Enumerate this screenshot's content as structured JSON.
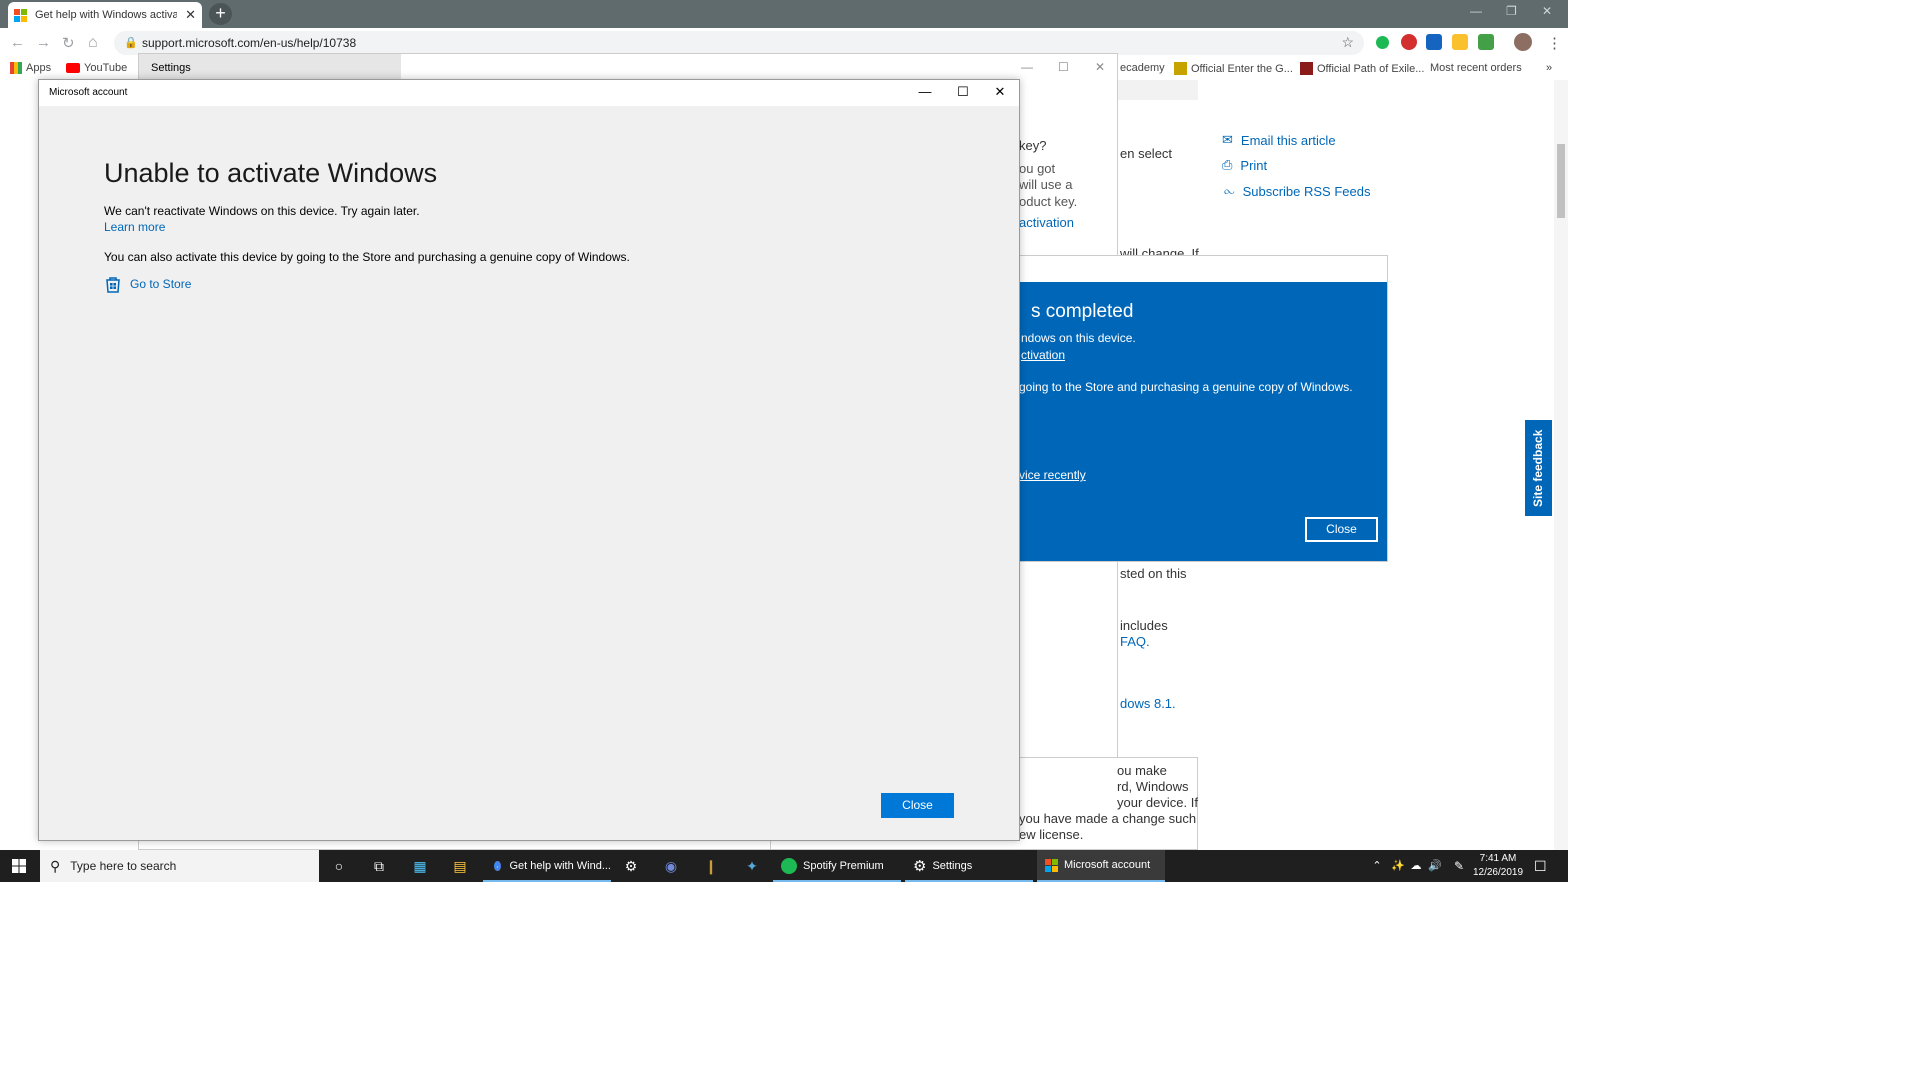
{
  "browser": {
    "tab_title": "Get help with Windows activatio",
    "tab_close": "✕",
    "new_tab": "+",
    "url": "support.microsoft.com/en-us/help/10738",
    "bookmarks": [
      {
        "label": "Apps"
      },
      {
        "label": "YouTube"
      },
      {
        "label": "ecademy"
      },
      {
        "label": "Official Enter the G..."
      },
      {
        "label": "Official Path of Exile..."
      },
      {
        "label": "Most recent orders"
      }
    ],
    "more_bookmarks": "»"
  },
  "webpage": {
    "fragments": {
      "key": "key?",
      "you_got": "ou got",
      "will_use": "will use a",
      "product_key": "oduct key.",
      "activation": "activation",
      "then_select": "en select",
      "will_change": "will change. If",
      "sted_on": "sted on this",
      "includes": "includes",
      "faq": "FAQ.",
      "windows81": "dows 8.1.",
      "you_make": "ou make",
      "rd_windows": "rd, Windows",
      "your_device": "your device. If",
      "you_have_made": "you have made a change such",
      "new_license": "ew license."
    },
    "side_links": {
      "email": "Email this article",
      "print": "Print",
      "rss": "Subscribe RSS Feeds"
    },
    "site_feedback": "Site feedback"
  },
  "settings_window": {
    "title": "Settings"
  },
  "blue_dialog": {
    "title": "s completed",
    "line1": "ndows on this device.",
    "link1": "ctivation",
    "line2": " going to the Store and purchasing a genuine copy of Windows.",
    "link2": "vice recently",
    "close": "Close"
  },
  "ms_dialog": {
    "title": "Microsoft account",
    "heading": "Unable to activate Windows",
    "line1": "We can't reactivate Windows on this device. Try again later.",
    "learn_more": "Learn more",
    "line2": "You can also activate this device by going to the Store and purchasing a genuine copy of Windows.",
    "go_to_store": "Go to Store",
    "close": "Close"
  },
  "taskbar": {
    "search_placeholder": "Type here to search",
    "items": [
      {
        "label": "Get help with Wind..."
      },
      {
        "label": "Spotify Premium"
      },
      {
        "label": "Settings"
      },
      {
        "label": "Microsoft account"
      }
    ],
    "time": "7:41 AM",
    "date": "12/26/2019"
  },
  "colors": {
    "accent": "#0078d7",
    "link": "#0067b8",
    "chrome_frame": "#5f6b6d",
    "taskbar": "#1f1f1f"
  }
}
